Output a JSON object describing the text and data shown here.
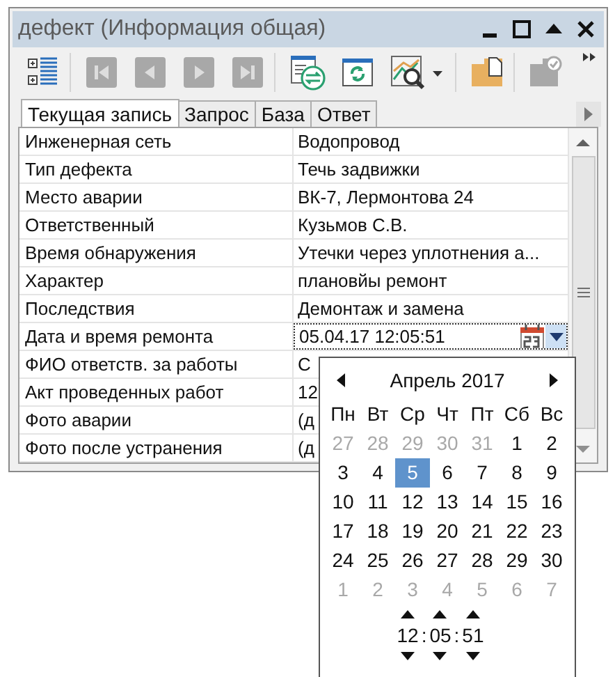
{
  "window": {
    "title": "дефект (Информация общая)"
  },
  "toolbar": [
    {
      "kind": "tree",
      "disabled": false
    },
    {
      "kind": "first",
      "disabled": true
    },
    {
      "kind": "prev",
      "disabled": true
    },
    {
      "kind": "next",
      "disabled": true
    },
    {
      "kind": "last",
      "disabled": true
    },
    {
      "kind": "sync",
      "disabled": false
    },
    {
      "kind": "refresh",
      "disabled": false
    },
    {
      "kind": "preview",
      "disabled": false
    },
    {
      "kind": "new",
      "disabled": false
    },
    {
      "kind": "confirm",
      "disabled": true
    }
  ],
  "tabs": [
    {
      "label": "Текущая запись",
      "selected": true
    },
    {
      "label": "Запрос",
      "selected": false
    },
    {
      "label": "База",
      "selected": false
    },
    {
      "label": "Ответ",
      "selected": false
    }
  ],
  "fields": [
    {
      "label": "Инженерная сеть",
      "value": "Водопровод",
      "kind": "text"
    },
    {
      "label": "Тип дефекта",
      "value": "Течь задвижки",
      "kind": "text"
    },
    {
      "label": "Место аварии",
      "value": "ВК-7, Лермонтова 24",
      "kind": "text"
    },
    {
      "label": "Ответственный",
      "value": "Кузьмов С.В.",
      "kind": "text"
    },
    {
      "label": "Время обнаружения",
      "value": "Утечки через уплотнения а...",
      "kind": "text"
    },
    {
      "label": "Характер",
      "value": "плановйы ремонт",
      "kind": "text"
    },
    {
      "label": "Последствия",
      "value": "Демонтаж и замена",
      "kind": "text"
    },
    {
      "label": "Дата и время ремонта",
      "value": "05.04.17 12:05:51",
      "kind": "date"
    },
    {
      "label": "ФИО ответств. за работы",
      "value": "С",
      "kind": "text"
    },
    {
      "label": "Акт проведенных работ",
      "value": "12",
      "kind": "text"
    },
    {
      "label": "Фото аварии",
      "value": "(д",
      "kind": "text"
    },
    {
      "label": "Фото после устранения",
      "value": "(д",
      "kind": "text"
    }
  ],
  "calendar": {
    "month": "Апрель 2017",
    "weekdays": [
      "Пн",
      "Вт",
      "Ср",
      "Чт",
      "Пт",
      "Сб",
      "Вс"
    ],
    "days": [
      {
        "text": "27",
        "other_month": true,
        "selected": false
      },
      {
        "text": "28",
        "other_month": true,
        "selected": false
      },
      {
        "text": "29",
        "other_month": true,
        "selected": false
      },
      {
        "text": "30",
        "other_month": true,
        "selected": false
      },
      {
        "text": "31",
        "other_month": true,
        "selected": false
      },
      {
        "text": "1",
        "other_month": false,
        "selected": false
      },
      {
        "text": "2",
        "other_month": false,
        "selected": false
      },
      {
        "text": "3",
        "other_month": false,
        "selected": false
      },
      {
        "text": "4",
        "other_month": false,
        "selected": false
      },
      {
        "text": "5",
        "other_month": false,
        "selected": true
      },
      {
        "text": "6",
        "other_month": false,
        "selected": false
      },
      {
        "text": "7",
        "other_month": false,
        "selected": false
      },
      {
        "text": "8",
        "other_month": false,
        "selected": false
      },
      {
        "text": "9",
        "other_month": false,
        "selected": false
      },
      {
        "text": "10",
        "other_month": false,
        "selected": false
      },
      {
        "text": "11",
        "other_month": false,
        "selected": false
      },
      {
        "text": "12",
        "other_month": false,
        "selected": false
      },
      {
        "text": "13",
        "other_month": false,
        "selected": false
      },
      {
        "text": "14",
        "other_month": false,
        "selected": false
      },
      {
        "text": "15",
        "other_month": false,
        "selected": false
      },
      {
        "text": "16",
        "other_month": false,
        "selected": false
      },
      {
        "text": "17",
        "other_month": false,
        "selected": false
      },
      {
        "text": "18",
        "other_month": false,
        "selected": false
      },
      {
        "text": "19",
        "other_month": false,
        "selected": false
      },
      {
        "text": "20",
        "other_month": false,
        "selected": false
      },
      {
        "text": "21",
        "other_month": false,
        "selected": false
      },
      {
        "text": "22",
        "other_month": false,
        "selected": false
      },
      {
        "text": "23",
        "other_month": false,
        "selected": false
      },
      {
        "text": "24",
        "other_month": false,
        "selected": false
      },
      {
        "text": "25",
        "other_month": false,
        "selected": false
      },
      {
        "text": "26",
        "other_month": false,
        "selected": false
      },
      {
        "text": "27",
        "other_month": false,
        "selected": false
      },
      {
        "text": "28",
        "other_month": false,
        "selected": false
      },
      {
        "text": "29",
        "other_month": false,
        "selected": false
      },
      {
        "text": "30",
        "other_month": false,
        "selected": false
      },
      {
        "text": "1",
        "other_month": true,
        "selected": false
      },
      {
        "text": "2",
        "other_month": true,
        "selected": false
      },
      {
        "text": "3",
        "other_month": true,
        "selected": false
      },
      {
        "text": "4",
        "other_month": true,
        "selected": false
      },
      {
        "text": "5",
        "other_month": true,
        "selected": false
      },
      {
        "text": "6",
        "other_month": true,
        "selected": false
      },
      {
        "text": "7",
        "other_month": true,
        "selected": false
      }
    ],
    "time": [
      {
        "kind": "value",
        "text": "12"
      },
      {
        "kind": "separator",
        "text": ":"
      },
      {
        "kind": "value",
        "text": "05"
      },
      {
        "kind": "separator",
        "text": ":"
      },
      {
        "kind": "value",
        "text": "51"
      }
    ]
  }
}
